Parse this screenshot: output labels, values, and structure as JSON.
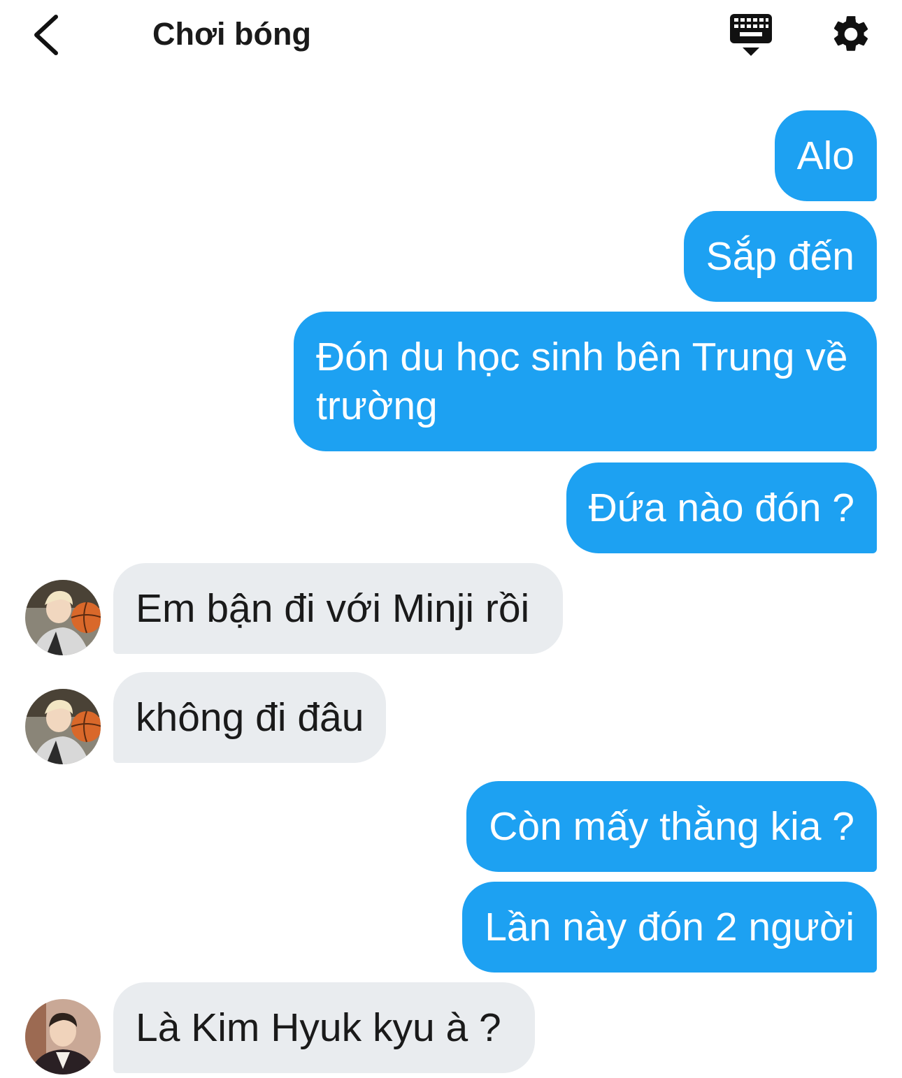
{
  "header": {
    "title": "Chơi bóng",
    "back_icon": "chevron-left-icon",
    "keyboard_icon": "keyboard-hide-icon",
    "settings_icon": "gear-icon"
  },
  "colors": {
    "outgoing_bubble": "#1da1f2",
    "incoming_bubble": "#e9ecef",
    "outgoing_text": "#ffffff",
    "incoming_text": "#1a1a1a"
  },
  "messages": [
    {
      "direction": "out",
      "text": "Alo"
    },
    {
      "direction": "out",
      "text": "Sắp đến"
    },
    {
      "direction": "out",
      "text": "Đón du học sinh bên Trung về trường"
    },
    {
      "direction": "out",
      "text": "Đứa nào đón ?"
    },
    {
      "direction": "in",
      "text": "Em bận đi với Minji rồi",
      "avatar": "avatar-basketball"
    },
    {
      "direction": "in",
      "text": "không đi đâu",
      "avatar": "avatar-basketball"
    },
    {
      "direction": "out",
      "text": "Còn mấy thằng kia ?"
    },
    {
      "direction": "out",
      "text": "Lần này đón 2 người"
    },
    {
      "direction": "in",
      "text": "Là Kim Hyuk kyu à ?",
      "avatar": "avatar-suit"
    }
  ]
}
